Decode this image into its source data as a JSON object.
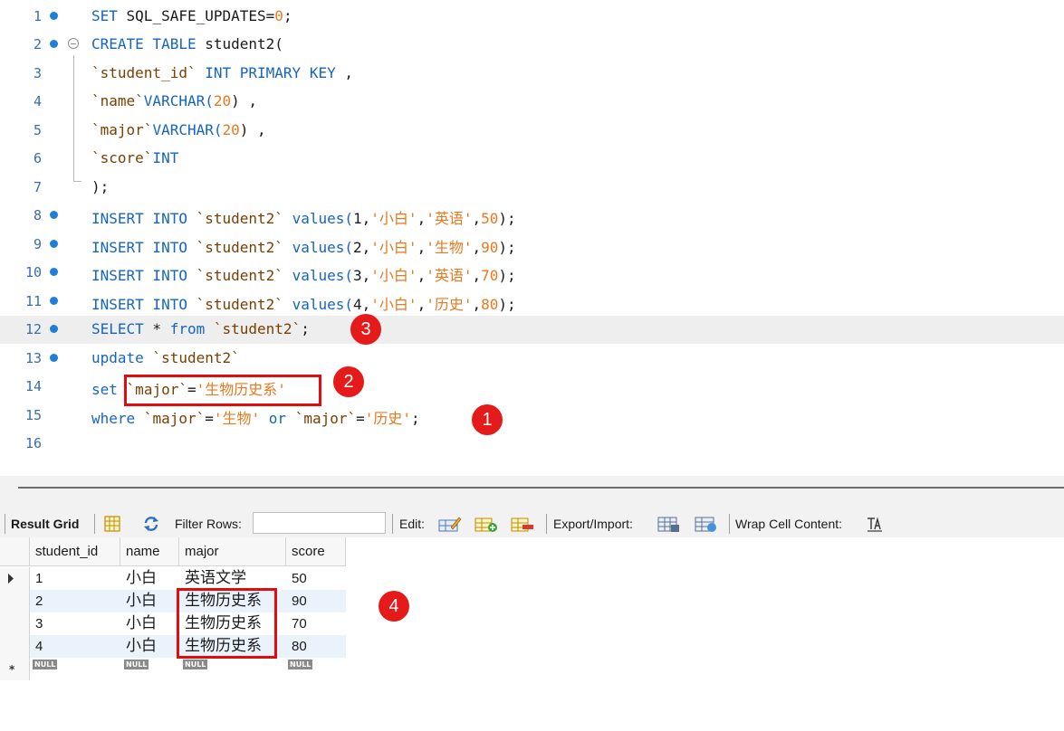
{
  "editor": {
    "lines": [
      {
        "n": "1"
      },
      {
        "n": "2"
      },
      {
        "n": "3"
      },
      {
        "n": "4"
      },
      {
        "n": "5"
      },
      {
        "n": "6"
      },
      {
        "n": "7"
      },
      {
        "n": "8"
      },
      {
        "n": "9"
      },
      {
        "n": "10"
      },
      {
        "n": "11"
      },
      {
        "n": "12"
      },
      {
        "n": "13"
      },
      {
        "n": "14"
      },
      {
        "n": "15"
      },
      {
        "n": "16"
      }
    ],
    "code": {
      "l1_kw": "SET",
      "l1_rest": " SQL_SAFE_UPDATES=",
      "l1_num": "0",
      "l1_end": ";",
      "l2_kw": "CREATE TABLE",
      "l2_rest": " student2(",
      "l3_col": "`student_id`",
      "l3_kw": " INT PRIMARY KEY",
      "l3_end": " ,",
      "l4_col": "`name`",
      "l4_kw": "VARCHAR(",
      "l4_num": "20",
      "l4_end": ") ,",
      "l5_col": "`major`",
      "l5_kw": "VARCHAR(",
      "l5_num": "20",
      "l5_end": ") ,",
      "l6_col": "`score`",
      "l6_kw": "INT",
      "l7": ");",
      "insert_kw": "INSERT INTO",
      "tbl": "`student2`",
      "values_kw": "values(",
      "i1_id": "1",
      "i1_name": "'小白'",
      "i1_major": "'英语'",
      "i1_score": "50",
      "i2_id": "2",
      "i2_name": "'小白'",
      "i2_major": "'生物'",
      "i2_score": "90",
      "i3_id": "3",
      "i3_name": "'小白'",
      "i3_major": "'英语'",
      "i3_score": "70",
      "i4_id": "4",
      "i4_name": "'小白'",
      "i4_major": "'历史'",
      "i4_score": "80",
      "l12_kw1": "SELECT",
      "l12_star": " * ",
      "l12_kw2": "from",
      "l12_tbl": " `student2`",
      "l12_end": ";",
      "l13_kw": "update",
      "l13_tbl": " `student2`",
      "l14_kw": "set",
      "l14_col": "`major`",
      "l14_eq": "=",
      "l14_val": "'生物历史系'",
      "l15_kw": "where",
      "l15_col1": " `major`",
      "l15_eq1": "=",
      "l15_val1": "'生物'",
      "l15_or": " or ",
      "l15_col2": "`major`",
      "l15_eq2": "=",
      "l15_val2": "'历史'",
      "l15_end": ";",
      "comma": ",",
      "close": ");"
    }
  },
  "annotations": {
    "b1": "1",
    "b2": "2",
    "b3": "3",
    "b4": "4"
  },
  "toolbar": {
    "result_grid": "Result Grid",
    "filter_rows": "Filter Rows:",
    "filter_value": "",
    "edit": "Edit:",
    "export_import": "Export/Import:",
    "wrap_cell": "Wrap Cell Content:"
  },
  "grid": {
    "columns": [
      "student_id",
      "name",
      "major",
      "score"
    ],
    "rows": [
      [
        "1",
        "小白",
        "英语文学",
        "50"
      ],
      [
        "2",
        "小白",
        "生物历史系",
        "90"
      ],
      [
        "3",
        "小白",
        "生物历史系",
        "70"
      ],
      [
        "4",
        "小白",
        "生物历史系",
        "80"
      ]
    ],
    "null_label": "NULL"
  },
  "colors": {
    "keyword": "#1565c0",
    "string": "#e8781e",
    "annotation_red": "#e10d0d",
    "alt_row": "#eaf2fc"
  }
}
